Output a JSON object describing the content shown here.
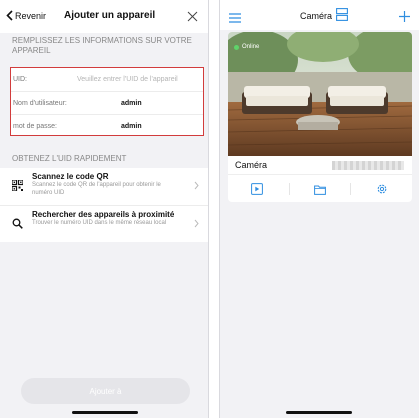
{
  "add_device": {
    "back_label": "Revenir",
    "title": "Ajouter un appareil",
    "section_fill": "REMPLISSEZ LES INFORMATIONS SUR VOTRE APPAREIL",
    "fields": [
      {
        "label": "UID:",
        "value": "",
        "placeholder": "Veuillez entrer l'UID de l'appareil"
      },
      {
        "label": "Nom d'utilisateur:",
        "value": "admin",
        "placeholder": ""
      },
      {
        "label": "mot de passe:",
        "value": "admin",
        "placeholder": ""
      }
    ],
    "section_quick": "OBTENEZ L'UID RAPIDEMENT",
    "quick_items": [
      {
        "title": "Scannez le code QR",
        "subtitle": "Scannez le code QR de l'appareil pour obtenir le numéro UID",
        "icon": "qr-code-icon"
      },
      {
        "title": "Rechercher des appareils à proximité",
        "subtitle": "Trouver le numéro UID dans le même réseau local",
        "icon": "search-icon"
      }
    ],
    "submit_label": "Ajouter à"
  },
  "camera_list": {
    "title": "Caméra",
    "cards": [
      {
        "name": "Caméra",
        "status": "Online"
      }
    ]
  },
  "colors": {
    "accent": "#2f8ee0",
    "error_border": "#d23c3c",
    "online": "#5fd36a"
  }
}
